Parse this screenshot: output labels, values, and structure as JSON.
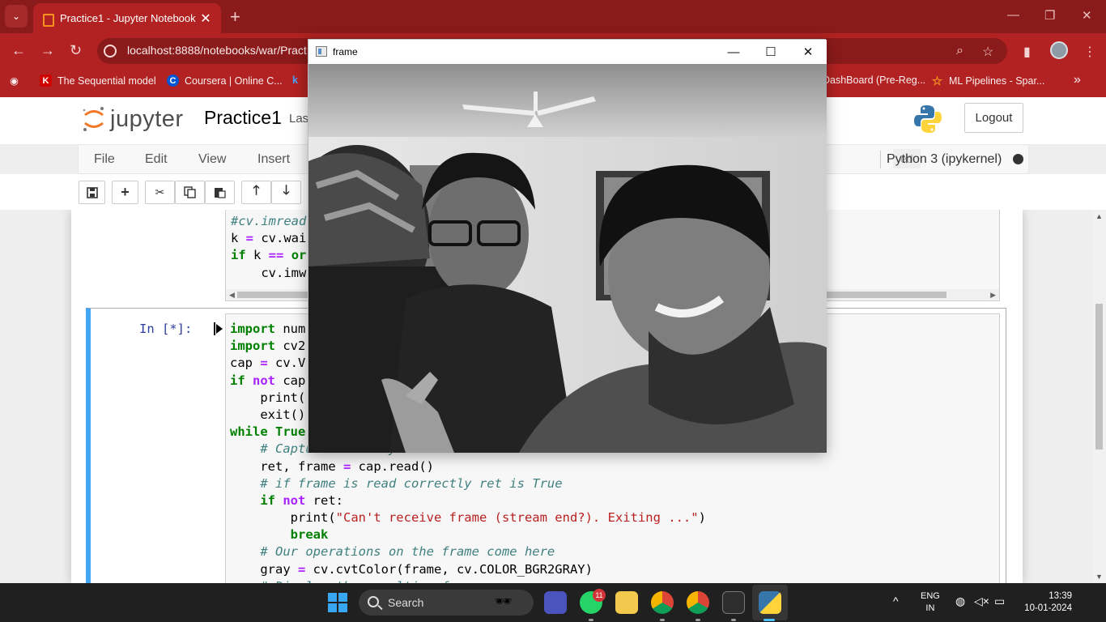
{
  "browser": {
    "tab_title": "Practice1 - Jupyter Notebook",
    "tab_close": "✕",
    "new_tab": "+",
    "url": "localhost:8888/notebooks/war/Pract",
    "bookmarks": [
      {
        "label": "The Sequential model",
        "icon_text": "K",
        "icon_color": "#d00000"
      },
      {
        "label": "Coursera | Online C...",
        "icon_text": "C",
        "icon_color": "#0056d2"
      },
      {
        "label": "DashBoard (Pre-Reg...",
        "icon_text": "",
        "icon_color": ""
      },
      {
        "label": "ML Pipelines - Spar...",
        "icon_text": "☆",
        "icon_color": "#f7931e"
      }
    ],
    "bookmark_partial_letter": "k"
  },
  "jupyter": {
    "logo_text": "jupyter",
    "notebook_name": "Practice1",
    "last_saved_partial": "Las",
    "logout": "Logout",
    "menu": [
      "File",
      "Edit",
      "View",
      "Insert"
    ],
    "trusted_partial": "ed",
    "kernel": "Python 3 (ipykernel)"
  },
  "cell1_lines": [
    [
      {
        "t": "#cv.imread",
        "c": "cm"
      }
    ],
    [
      {
        "t": "k ",
        "c": ""
      },
      {
        "t": "=",
        "c": "op"
      },
      {
        "t": " cv.wai",
        "c": ""
      }
    ],
    [
      {
        "t": "if",
        "c": "kw"
      },
      {
        "t": " k ",
        "c": ""
      },
      {
        "t": "==",
        "c": "op"
      },
      {
        "t": " ",
        "c": ""
      },
      {
        "t": "or",
        "c": "kw"
      }
    ],
    [
      {
        "t": "    cv.imw",
        "c": ""
      }
    ]
  ],
  "cell2_prompt": "In [*]:",
  "cell2_lines": [
    [
      {
        "t": "import",
        "c": "kw"
      },
      {
        "t": " num",
        "c": ""
      }
    ],
    [
      {
        "t": "import",
        "c": "kw"
      },
      {
        "t": " cv2",
        "c": ""
      }
    ],
    [
      {
        "t": "cap ",
        "c": ""
      },
      {
        "t": "=",
        "c": "op"
      },
      {
        "t": " cv.V",
        "c": ""
      }
    ],
    [
      {
        "t": "if",
        "c": "kw"
      },
      {
        "t": " ",
        "c": ""
      },
      {
        "t": "not",
        "c": "op"
      },
      {
        "t": " cap",
        "c": ""
      }
    ],
    [
      {
        "t": "    print(",
        "c": ""
      }
    ],
    [
      {
        "t": "    exit()",
        "c": ""
      }
    ],
    [
      {
        "t": "while",
        "c": "kw"
      },
      {
        "t": " ",
        "c": ""
      },
      {
        "t": "True",
        "c": "kw"
      }
    ],
    [
      {
        "t": "    ",
        "c": ""
      },
      {
        "t": "# Capture frame-by-frame",
        "c": "cm"
      }
    ],
    [
      {
        "t": "    ret, frame ",
        "c": ""
      },
      {
        "t": "=",
        "c": "op"
      },
      {
        "t": " cap.read()",
        "c": ""
      }
    ],
    [
      {
        "t": "    ",
        "c": ""
      },
      {
        "t": "# if frame is read correctly ret is True",
        "c": "cm"
      }
    ],
    [
      {
        "t": "    ",
        "c": ""
      },
      {
        "t": "if",
        "c": "kw"
      },
      {
        "t": " ",
        "c": ""
      },
      {
        "t": "not",
        "c": "op"
      },
      {
        "t": " ret:",
        "c": ""
      }
    ],
    [
      {
        "t": "        print(",
        "c": ""
      },
      {
        "t": "\"Can't receive frame (stream end?). Exiting ...\"",
        "c": "st"
      },
      {
        "t": ")",
        "c": ""
      }
    ],
    [
      {
        "t": "        ",
        "c": ""
      },
      {
        "t": "break",
        "c": "kw"
      }
    ],
    [
      {
        "t": "    ",
        "c": ""
      },
      {
        "t": "# Our operations on the frame come here",
        "c": "cm"
      }
    ],
    [
      {
        "t": "    gray ",
        "c": ""
      },
      {
        "t": "=",
        "c": "op"
      },
      {
        "t": " cv.cvtColor(frame, cv.COLOR_BGR2GRAY)",
        "c": ""
      }
    ],
    [
      {
        "t": "    ",
        "c": ""
      },
      {
        "t": "# Display the resulting frame",
        "c": "cm"
      }
    ]
  ],
  "frame_window": {
    "title": "frame",
    "minimize": "—",
    "maximize": "☐",
    "close": "✕"
  },
  "taskbar": {
    "search": "Search",
    "whatsapp_badge": "11",
    "lang_top": "ENG",
    "lang_bottom": "IN",
    "time": "13:39",
    "date": "10-01-2024"
  }
}
